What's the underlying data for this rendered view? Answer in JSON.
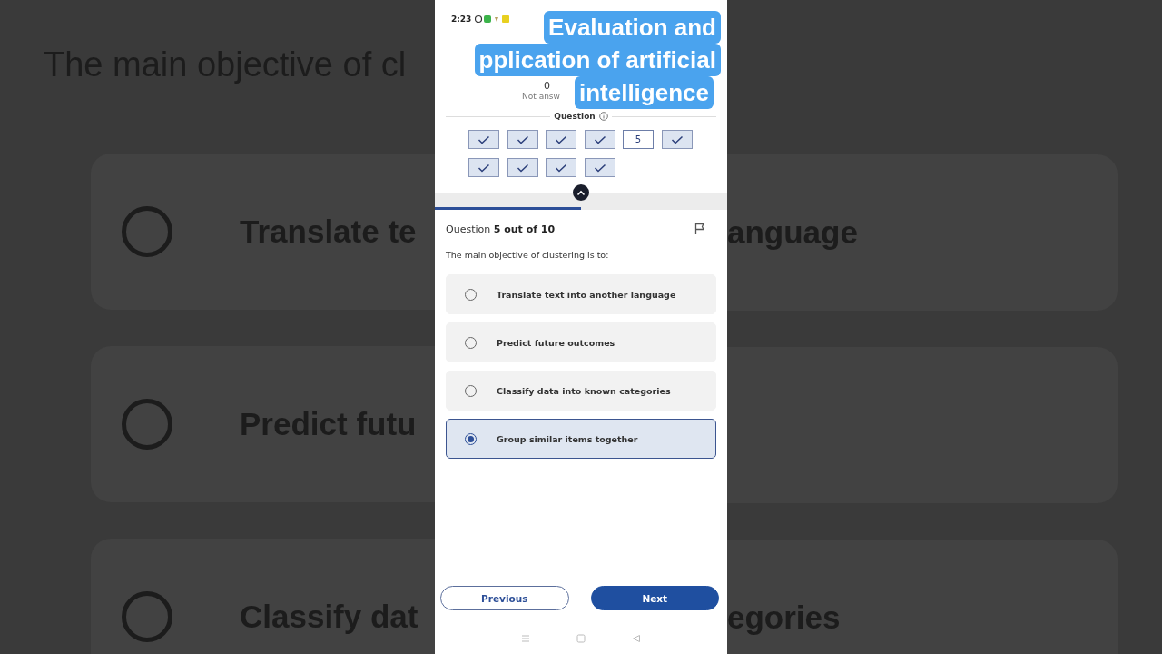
{
  "backdrop": {
    "title": "The main objective of cl",
    "left_rows": [
      {
        "label": "Translate te"
      },
      {
        "label": "Predict futu"
      },
      {
        "label": "Classify dat"
      }
    ],
    "right_rows": [
      {
        "kind": "text",
        "label": "anguage"
      },
      {
        "kind": "blank"
      },
      {
        "kind": "text",
        "label": "egories"
      }
    ]
  },
  "status_bar": {
    "time": "2:23"
  },
  "caption": [
    "Evaluation and",
    "pplication of artificial",
    "intelligence"
  ],
  "summary": {
    "count": "0",
    "label": "Not answ"
  },
  "palette": {
    "title": "Question",
    "items": [
      {
        "answered": true,
        "current": false
      },
      {
        "answered": true,
        "current": false
      },
      {
        "answered": true,
        "current": false
      },
      {
        "answered": true,
        "current": false
      },
      {
        "answered": false,
        "current": true,
        "label": "5"
      },
      {
        "answered": true,
        "current": false
      },
      {
        "answered": true,
        "current": false
      },
      {
        "answered": true,
        "current": false
      },
      {
        "answered": true,
        "current": false
      },
      {
        "answered": true,
        "current": false
      }
    ]
  },
  "progress": {
    "level": 0.5
  },
  "question": {
    "prefix": "Question",
    "position": "5 out of 10",
    "text": "The main objective of clustering is to:",
    "options": [
      {
        "label": "Translate text into another language",
        "selected": false
      },
      {
        "label": "Predict future outcomes",
        "selected": false
      },
      {
        "label": "Classify data into known categories",
        "selected": false
      },
      {
        "label": "Group similar items together",
        "selected": true
      }
    ]
  },
  "buttons": {
    "previous": "Previous",
    "next": "Next"
  }
}
